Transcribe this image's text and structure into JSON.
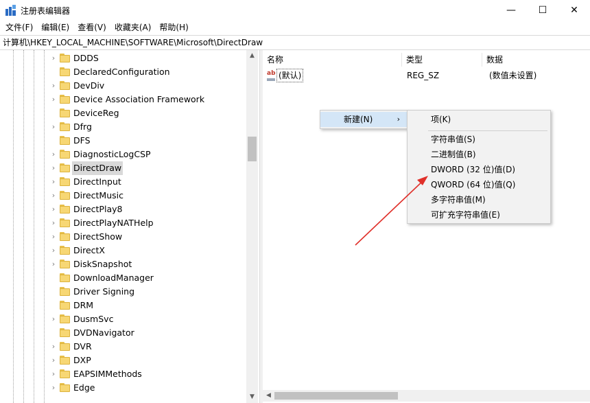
{
  "window": {
    "title": "注册表编辑器",
    "controls": {
      "minimize": "—",
      "maximize": "☐",
      "close": "✕"
    }
  },
  "menubar": {
    "items": [
      "文件(F)",
      "编辑(E)",
      "查看(V)",
      "收藏夹(A)",
      "帮助(H)"
    ]
  },
  "address": {
    "path": "计算机\\HKEY_LOCAL_MACHINE\\SOFTWARE\\Microsoft\\DirectDraw"
  },
  "tree": {
    "items": [
      {
        "label": "DDDS",
        "expandable": true
      },
      {
        "label": "DeclaredConfiguration",
        "expandable": false
      },
      {
        "label": "DevDiv",
        "expandable": true
      },
      {
        "label": "Device Association Framework",
        "expandable": true
      },
      {
        "label": "DeviceReg",
        "expandable": false
      },
      {
        "label": "Dfrg",
        "expandable": true
      },
      {
        "label": "DFS",
        "expandable": false
      },
      {
        "label": "DiagnosticLogCSP",
        "expandable": true
      },
      {
        "label": "DirectDraw",
        "expandable": true,
        "selected": true
      },
      {
        "label": "DirectInput",
        "expandable": true
      },
      {
        "label": "DirectMusic",
        "expandable": true
      },
      {
        "label": "DirectPlay8",
        "expandable": true
      },
      {
        "label": "DirectPlayNATHelp",
        "expandable": true
      },
      {
        "label": "DirectShow",
        "expandable": true
      },
      {
        "label": "DirectX",
        "expandable": true
      },
      {
        "label": "DiskSnapshot",
        "expandable": true
      },
      {
        "label": "DownloadManager",
        "expandable": false
      },
      {
        "label": "Driver Signing",
        "expandable": false
      },
      {
        "label": "DRM",
        "expandable": false
      },
      {
        "label": "DusmSvc",
        "expandable": true
      },
      {
        "label": "DVDNavigator",
        "expandable": false
      },
      {
        "label": "DVR",
        "expandable": true
      },
      {
        "label": "DXP",
        "expandable": true
      },
      {
        "label": "EAPSIMMethods",
        "expandable": true
      },
      {
        "label": "Edge",
        "expandable": true
      }
    ]
  },
  "values": {
    "headers": {
      "name": "名称",
      "type": "类型",
      "data": "数据"
    },
    "rows": [
      {
        "name": "(默认)",
        "type": "REG_SZ",
        "data": "(数值未设置)"
      }
    ]
  },
  "context_menu": {
    "new_label": "新建(N)",
    "submenu_arrow": "›",
    "submenu": {
      "key": "项(K)",
      "items": [
        "字符串值(S)",
        "二进制值(B)",
        "DWORD (32 位)值(D)",
        "QWORD (64 位)值(Q)",
        "多字符串值(M)",
        "可扩充字符串值(E)"
      ]
    }
  },
  "colors": {
    "highlight": "#d4e6f7",
    "selected": "#d9d9d9",
    "arrow": "#e0302a",
    "folder": "#f7d774"
  }
}
